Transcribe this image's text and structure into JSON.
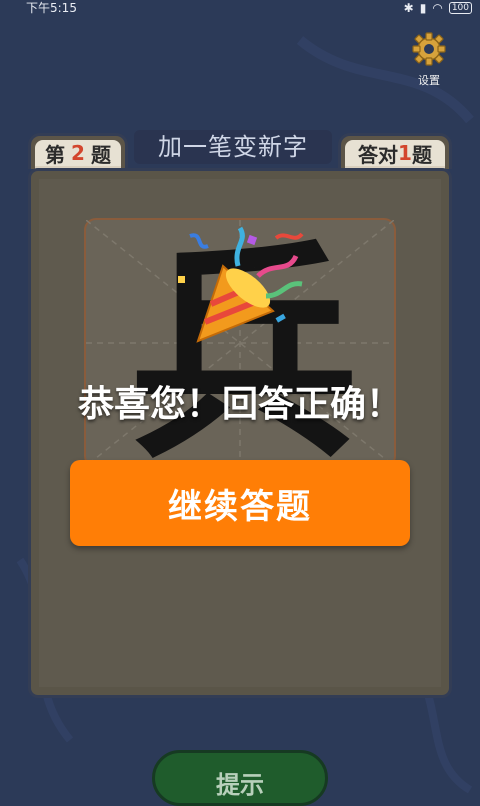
{
  "status_bar": {
    "time": "下午5:15",
    "battery": "100"
  },
  "settings": {
    "label": "设置",
    "icon": "gear-icon"
  },
  "header": {
    "question_prefix": "第",
    "question_number": "2",
    "question_suffix": "题",
    "title": "加一笔变新字",
    "correct_prefix": "答对",
    "correct_count": "1",
    "correct_suffix": "题"
  },
  "board": {
    "character": "兵"
  },
  "overlay": {
    "icon": "party-popper-icon",
    "message": "恭喜您！回答正确！",
    "continue_label": "继续答题"
  },
  "footer": {
    "hint_label": "提示"
  },
  "colors": {
    "background": "#2c3a58",
    "accent_orange": "#ff7e06",
    "hint_green": "#1f5c2c",
    "number_red": "#d3462e"
  }
}
